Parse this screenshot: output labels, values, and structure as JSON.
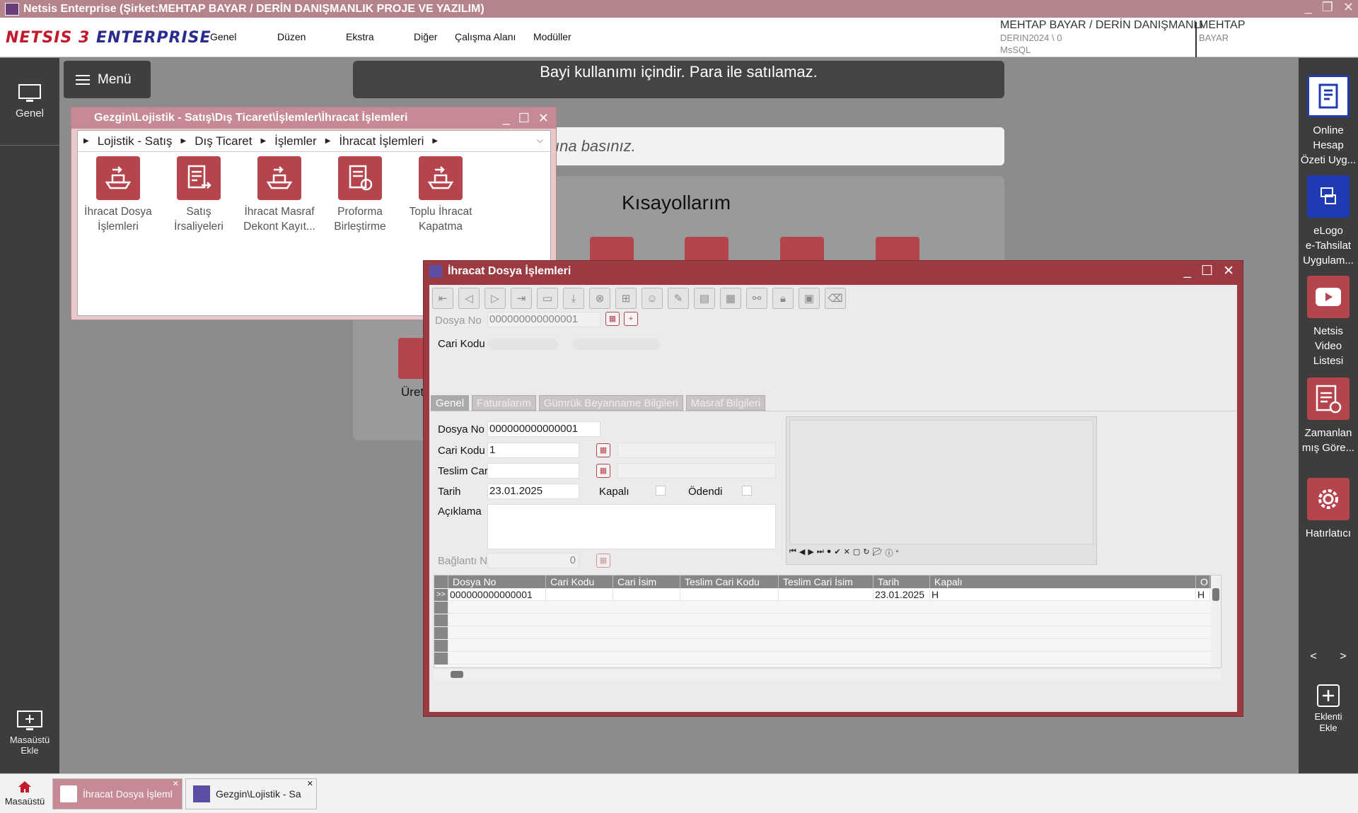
{
  "app": {
    "title": "Netsis Enterprise (Şirket:MEHTAP BAYAR / DERİN DANIŞMANLIK PROJE VE YAZILIM)",
    "logo_brand_a": "NETSIS 3",
    "logo_brand_b": "ENTERPRISE"
  },
  "menu": {
    "items": [
      "Genel",
      "Düzen",
      "Ekstra",
      "Diğer",
      "Çalışma Alanı",
      "Modüller"
    ]
  },
  "company": {
    "name": "MEHTAP BAYAR / DERİN DANIŞMANLI",
    "db": "DERIN2024 \\ 0",
    "engine": "MsSQL",
    "user_line1": "MEHTAP",
    "user_line2": "BAYAR"
  },
  "left_sidebar": {
    "genel": "Genel",
    "masaustu_ekle_1": "Masaüstü",
    "masaustu_ekle_2": "Ekle"
  },
  "right_sidebar": {
    "items": [
      {
        "l1": "Online",
        "l2": "Hesap",
        "l3": "Özeti Uyg...",
        "icon": "document-icon"
      },
      {
        "l1": "eLogo",
        "l2": "e-Tahsilat",
        "l3": "Uygulam...",
        "icon": "payment-icon"
      },
      {
        "l1": "Netsis",
        "l2": "Video",
        "l3": "Listesi",
        "icon": "video-icon"
      },
      {
        "l1": "Zamanlan",
        "l2": "mış Göre...",
        "l3": "",
        "icon": "scheduled-task-icon"
      },
      {
        "l1": "Hatırlatıcı",
        "l2": "",
        "l3": "",
        "icon": "gear-icon"
      }
    ],
    "prev": "<",
    "next": ">",
    "eklenti_1": "Eklenti",
    "eklenti_2": "Ekle"
  },
  "desktop": {
    "menu_button": "Menü",
    "banner": "Bayi kullanımı içindir. Para ile satılamaz.",
    "search_hint": "ına basınız.",
    "shortcuts_title": "Kısayollarım",
    "uret_label": "Üret"
  },
  "gezgin": {
    "title": "Gezgin\\Lojistik - Satış\\Dış Ticaret\\İşlemler\\İhracat İşlemleri",
    "breadcrumb": [
      "Lojistik - Satış",
      "Dış Ticaret",
      "İşlemler",
      "İhracat İşlemleri"
    ],
    "items": [
      {
        "l1": "İhracat Dosya",
        "l2": "İşlemleri"
      },
      {
        "l1": "Satış",
        "l2": "İrsaliyeleri"
      },
      {
        "l1": "İhracat Masraf",
        "l2": "Dekont Kayıt..."
      },
      {
        "l1": "Proforma",
        "l2": "Birleştirme"
      },
      {
        "l1": "Toplu İhracat",
        "l2": "Kapatma"
      }
    ]
  },
  "ihracat": {
    "title": "İhracat Dosya İşlemleri",
    "header": {
      "dosya_no_label": "Dosya No",
      "dosya_no_value": "000000000000001",
      "cari_kodu_label": "Cari Kodu"
    },
    "tabs": [
      "Genel",
      "Faturalarım",
      "Gümrük Beyanname Bilgileri",
      "Masraf Bilgileri"
    ],
    "form": {
      "dosya_no_label": "Dosya No",
      "dosya_no_value": "000000000000001",
      "cari_kodu_label": "Cari Kodu",
      "cari_kodu_value": "1",
      "teslim_cari_label": "Teslim Cari",
      "tarih_label": "Tarih",
      "tarih_value": "23.01.2025",
      "kapali_label": "Kapalı",
      "odendi_label": "Ödendi",
      "aciklama_label": "Açıklama",
      "baglanti_no_label": "Bağlantı No",
      "baglanti_no_value": "0"
    },
    "grid": {
      "columns": [
        "Dosya No",
        "Cari Kodu",
        "Cari İsim",
        "Teslim Cari Kodu",
        "Teslim Cari İsim",
        "Tarih",
        "Kapalı",
        "O"
      ],
      "rows": [
        {
          "ind": ">>",
          "dosya_no": "000000000000001",
          "cari_kodu": "",
          "cari_isim": "",
          "teslim_cari_kodu": "",
          "teslim_cari_isim": "",
          "tarih": "23.01.2025",
          "kapali": "H",
          "o": "H"
        }
      ]
    }
  },
  "taskbar": {
    "home": "Masaüstü",
    "tasks": [
      "İhracat Dosya İşleml",
      "Gezgin\\Lojistik - Sa"
    ]
  },
  "colors": {
    "accent": "#b5444d",
    "window_frame": "#9c3a42",
    "titlebar": "#b5838b",
    "sidebar": "#3d3d3d",
    "tile_blue": "#1f3bb3"
  }
}
